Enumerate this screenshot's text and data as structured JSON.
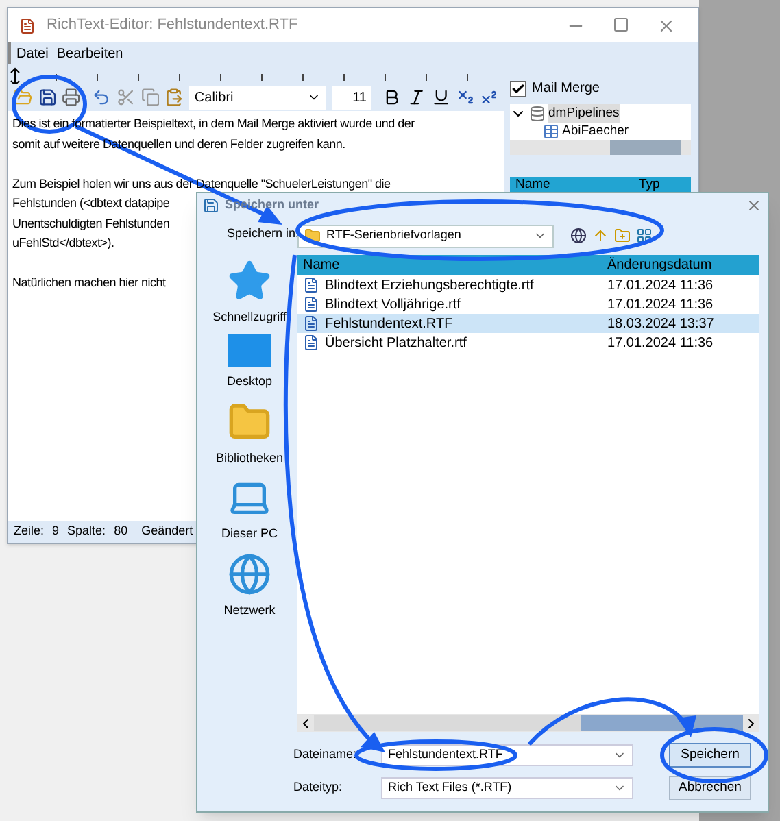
{
  "editor": {
    "title": "RichText-Editor: Fehlstundentext.RTF",
    "menu": [
      "Datei",
      "Bearbeiten"
    ],
    "font": "Calibri",
    "size": "11",
    "mail_merge": {
      "label": "Mail Merge",
      "checked": true
    },
    "tree": {
      "root": "dmPipelines",
      "expanded": true,
      "children": [
        "AbiFaecher"
      ]
    },
    "field_columns": [
      "Name",
      "Typ"
    ],
    "paragraphs": [
      [
        "Dies ist ein formatierter Beispieltext, in dem Mail Merge aktiviert wurde und der",
        "somit auf weitere Datenquellen und deren Felder zugreifen kann."
      ],
      [
        "Zum Beispiel holen wir uns aus der Datenquelle \"SchuelerLeistungen\" die",
        "Fehlstunden (<dbtext datapipe",
        "Unentschuldigten Fehlstunden",
        "uFehlStd</dbtext>)."
      ],
      [
        "Natürlichen machen hier nicht"
      ]
    ],
    "status": {
      "row_label": "Zeile:",
      "row": "9",
      "col_label": "Spalte:",
      "col": "80",
      "state": "Geändert"
    }
  },
  "dialog": {
    "title": "Speichern unter",
    "save_in_label": "Speichern in:",
    "folder": "RTF-Serienbriefvorlagen",
    "places": [
      {
        "label": "Schnellzugriff",
        "kind": "quick"
      },
      {
        "label": "Desktop",
        "kind": "desktop"
      },
      {
        "label": "Bibliotheken",
        "kind": "libraries"
      },
      {
        "label": "Dieser PC",
        "kind": "pc"
      },
      {
        "label": "Netzwerk",
        "kind": "network"
      }
    ],
    "columns": [
      "Name",
      "Änderungsdatum"
    ],
    "files": [
      {
        "name": "Blindtext Erziehungsberechtigte.rtf",
        "date": "17.01.2024 11:36",
        "selected": false
      },
      {
        "name": "Blindtext Volljährige.rtf",
        "date": "17.01.2024 11:36",
        "selected": false
      },
      {
        "name": "Fehlstundentext.RTF",
        "date": "18.03.2024 13:37",
        "selected": true
      },
      {
        "name": "Übersicht Platzhalter.rtf",
        "date": "17.01.2024 11:36",
        "selected": false
      }
    ],
    "filename_label": "Dateiname:",
    "filename": "Fehlstundentext.RTF",
    "filetype_label": "Dateityp:",
    "filetype": "Rich Text Files (*.RTF)",
    "buttons": [
      {
        "label": "Speichern",
        "kind": "default"
      },
      {
        "label": "Abbrechen",
        "kind": "normal"
      }
    ]
  }
}
